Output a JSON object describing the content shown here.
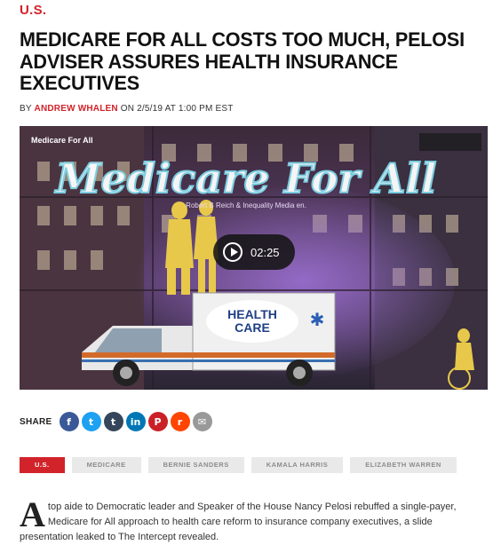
{
  "section": "U.S.",
  "headline": "MEDICARE FOR ALL COSTS TOO MUCH, PELOSI ADVISER ASSURES HEALTH INSURANCE EXECUTIVES",
  "byline": {
    "prefix": "BY",
    "author": "ANDREW WHALEN",
    "date_text": "ON 2/5/19 AT 1:00 PM EST"
  },
  "video": {
    "title": "Medicare For All",
    "neon_text": "Medicare For All",
    "credit": "Robert B Reich & Inequality Media en.",
    "ambulance_label_line1": "HEALTH",
    "ambulance_label_line2": "CARE",
    "duration": "02:25"
  },
  "share": {
    "label": "SHARE",
    "buttons": [
      {
        "name": "facebook-icon",
        "glyph": "f",
        "color": "#3b5998"
      },
      {
        "name": "twitter-icon",
        "glyph": "t",
        "color": "#1da1f2"
      },
      {
        "name": "tumblr-icon",
        "glyph": "t",
        "color": "#35465c"
      },
      {
        "name": "linkedin-icon",
        "glyph": "in",
        "color": "#0077b5"
      },
      {
        "name": "pinterest-icon",
        "glyph": "P",
        "color": "#cb2027"
      },
      {
        "name": "reddit-icon",
        "glyph": "r",
        "color": "#ff4500"
      },
      {
        "name": "email-icon",
        "glyph": "✉",
        "color": "#999999"
      }
    ]
  },
  "tags": [
    "U.S.",
    "MEDICARE",
    "BERNIE SANDERS",
    "KAMALA HARRIS",
    "ELIZABETH WARREN"
  ],
  "article": {
    "dropcap": "A",
    "first_paragraph": "top aide to Democratic leader and Speaker of the House Nancy Pelosi rebuffed a single-payer, Medicare for All approach to health care reform to insurance company executives, a slide presentation leaked to The Intercept revealed."
  },
  "colors": {
    "accent": "#d2232a",
    "tag_bg": "#e9e9e9",
    "tag_text": "#8c8c8c"
  }
}
